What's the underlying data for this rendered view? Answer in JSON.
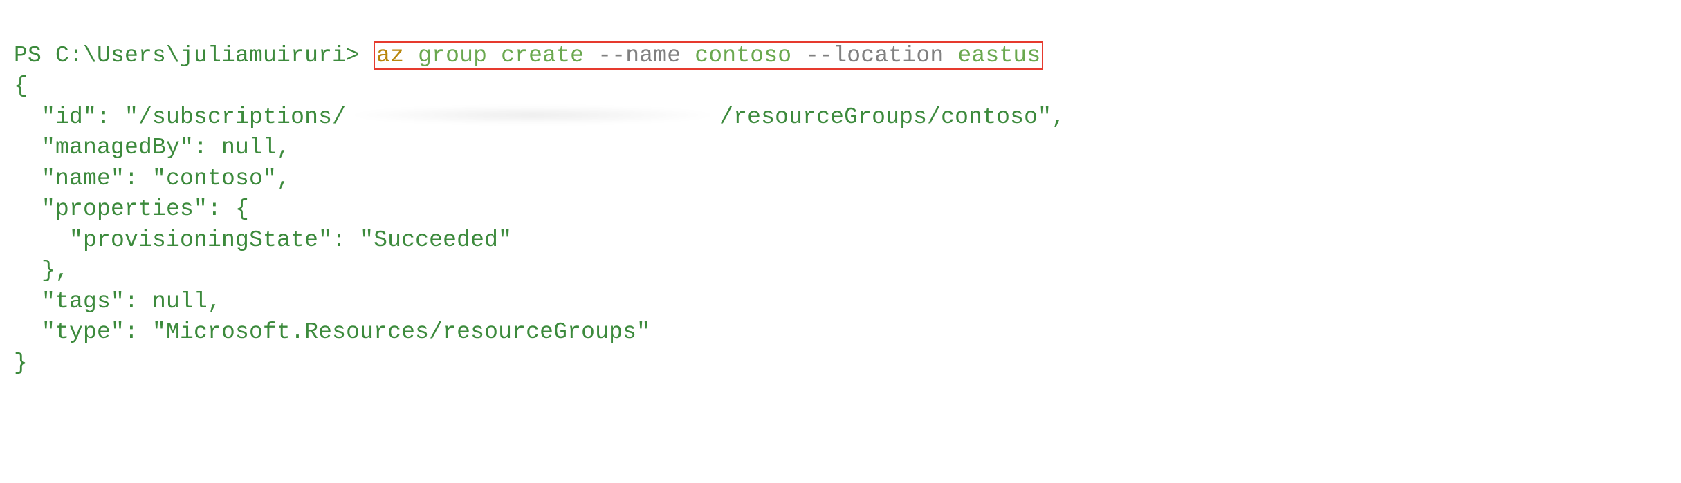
{
  "prompt": "PS C:\\Users\\juliamuiruri>",
  "command": {
    "base": "az",
    "group": "group create",
    "flag1": "--name",
    "arg1": "contoso",
    "flag2": "--location",
    "arg2": "eastus"
  },
  "output": {
    "brace_open": "{",
    "id_key": "  \"id\": \"/subscriptions/",
    "id_tail": "/resourceGroups/contoso\",",
    "managedBy": "  \"managedBy\": null,",
    "name": "  \"name\": \"contoso\",",
    "properties_open": "  \"properties\": {",
    "provisioningState": "    \"provisioningState\": \"Succeeded\"",
    "properties_close": "  },",
    "tags": "  \"tags\": null,",
    "type": "  \"type\": \"Microsoft.Resources/resourceGroups\"",
    "brace_close": "}"
  }
}
